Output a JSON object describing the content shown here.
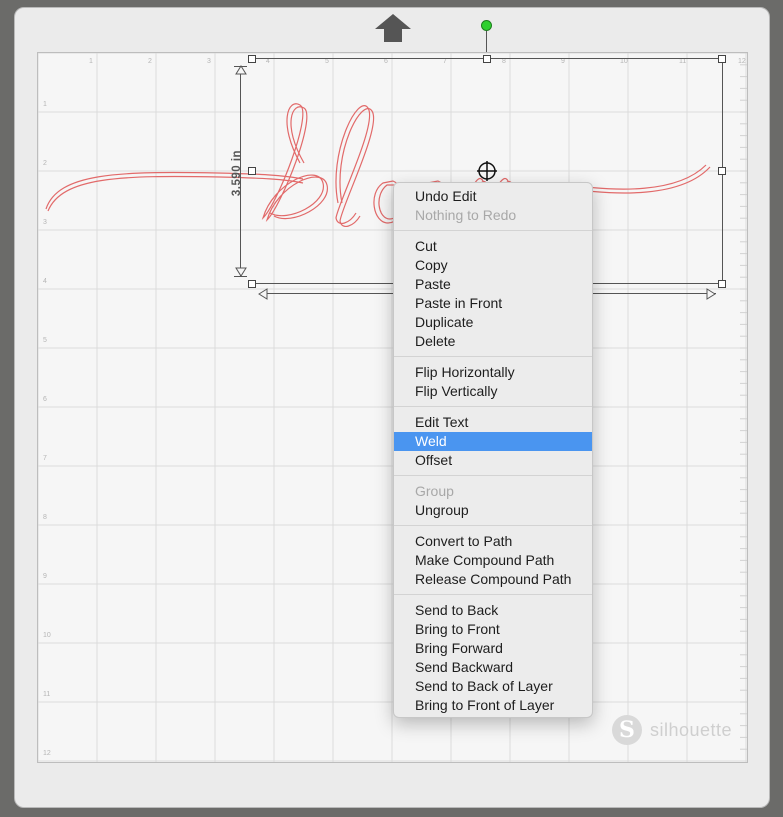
{
  "canvas": {
    "dimension_label": "3.590 in",
    "ruler_top": [
      "1",
      "2",
      "3",
      "4",
      "5",
      "6",
      "7",
      "8",
      "9",
      "10",
      "11",
      "12"
    ],
    "ruler_left": [
      "1",
      "2",
      "3",
      "4",
      "5",
      "6",
      "7",
      "8",
      "9",
      "10",
      "11",
      "12"
    ],
    "design_word": "bloom",
    "accent_color": "#e26a6a"
  },
  "context_menu": {
    "groups": [
      [
        {
          "label": "Undo Edit",
          "enabled": true
        },
        {
          "label": "Nothing to Redo",
          "enabled": false
        }
      ],
      [
        {
          "label": "Cut",
          "enabled": true
        },
        {
          "label": "Copy",
          "enabled": true
        },
        {
          "label": "Paste",
          "enabled": true
        },
        {
          "label": "Paste in Front",
          "enabled": true
        },
        {
          "label": "Duplicate",
          "enabled": true
        },
        {
          "label": "Delete",
          "enabled": true
        }
      ],
      [
        {
          "label": "Flip Horizontally",
          "enabled": true
        },
        {
          "label": "Flip Vertically",
          "enabled": true
        }
      ],
      [
        {
          "label": "Edit Text",
          "enabled": true
        },
        {
          "label": "Weld",
          "enabled": true,
          "selected": true
        },
        {
          "label": "Offset",
          "enabled": true
        }
      ],
      [
        {
          "label": "Group",
          "enabled": false
        },
        {
          "label": "Ungroup",
          "enabled": true
        }
      ],
      [
        {
          "label": "Convert to Path",
          "enabled": true
        },
        {
          "label": "Make Compound Path",
          "enabled": true
        },
        {
          "label": "Release Compound Path",
          "enabled": true
        }
      ],
      [
        {
          "label": "Send to Back",
          "enabled": true
        },
        {
          "label": "Bring to Front",
          "enabled": true
        },
        {
          "label": "Bring Forward",
          "enabled": true
        },
        {
          "label": "Send Backward",
          "enabled": true
        },
        {
          "label": "Send to Back of Layer",
          "enabled": true
        },
        {
          "label": "Bring to Front of Layer",
          "enabled": true
        }
      ]
    ]
  },
  "branding": {
    "logo_letter": "S",
    "name": "silhouette"
  },
  "icons": {
    "feed": "up-arrow-icon",
    "rotate_handle": "rotate-handle-icon",
    "cursor": "move-crosshair-icon"
  },
  "colors": {
    "menu_highlight": "#4a95f0",
    "rotate_handle": "#2fd02f",
    "design_stroke": "#e26a6a"
  }
}
